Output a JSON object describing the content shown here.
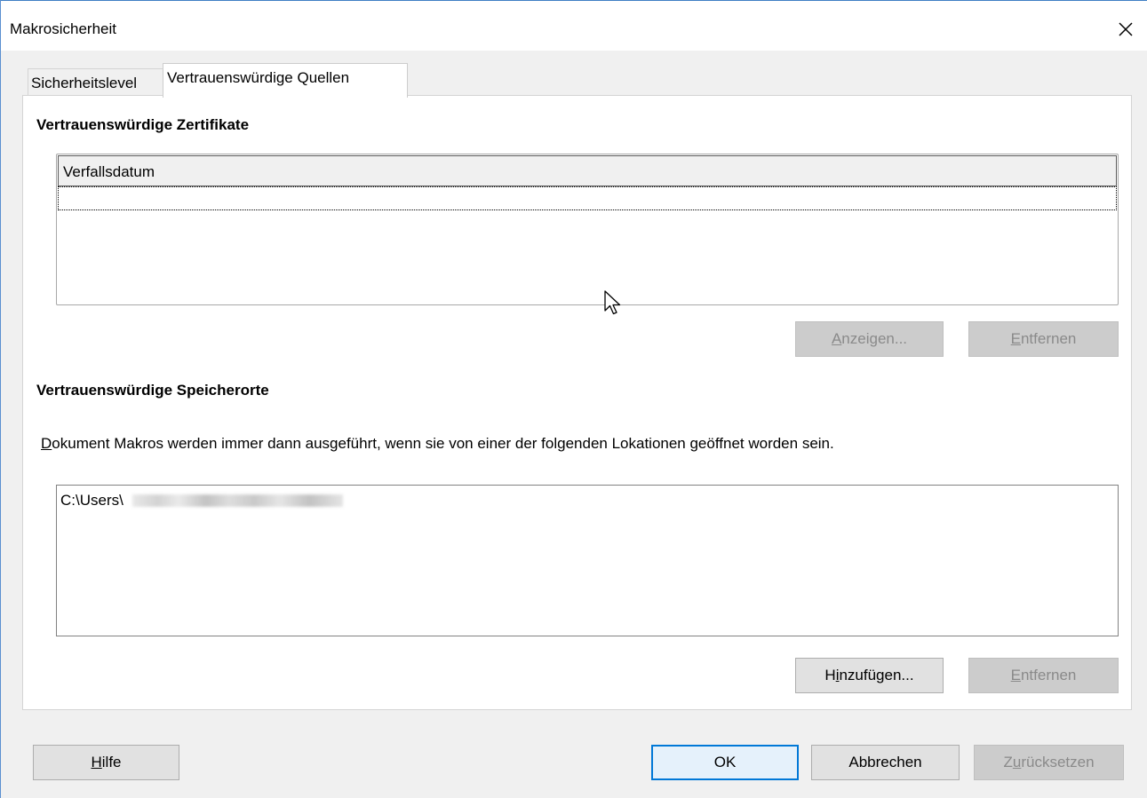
{
  "window": {
    "title": "Makrosicherheit"
  },
  "tabs": [
    {
      "label": "Sicherheitslevel",
      "active": false
    },
    {
      "label": "Vertrauenswürdige Quellen",
      "active": true
    }
  ],
  "certificates": {
    "title": "Vertrauenswürdige Zertifikate",
    "column_header": "Verfallsdatum",
    "buttons": {
      "view": {
        "pre": "",
        "key": "A",
        "post": "nzeigen..."
      },
      "remove": {
        "pre": "",
        "key": "E",
        "post": "ntfernen"
      }
    }
  },
  "locations": {
    "title": "Vertrauenswürdige Speicherorte",
    "description": {
      "key": "D",
      "rest": "okument Makros werden immer dann ausgeführt, wenn sie von einer der folgenden Lokationen geöffnet worden sein."
    },
    "items": [
      {
        "path": "C:\\Users\\"
      }
    ],
    "buttons": {
      "add": {
        "pre": "H",
        "key": "i",
        "post": "nzufügen..."
      },
      "remove": {
        "pre": "",
        "key": "E",
        "post": "ntfernen"
      }
    }
  },
  "footer": {
    "help": {
      "pre": "",
      "key": "H",
      "post": "ilfe"
    },
    "ok": "OK",
    "cancel": "Abbrechen",
    "reset": {
      "pre": "Z",
      "key": "u",
      "post": "rücksetzen"
    }
  },
  "colors": {
    "accent": "#0078d7",
    "disabled_button": "#cccccc",
    "window_border": "#3f7fc4"
  }
}
